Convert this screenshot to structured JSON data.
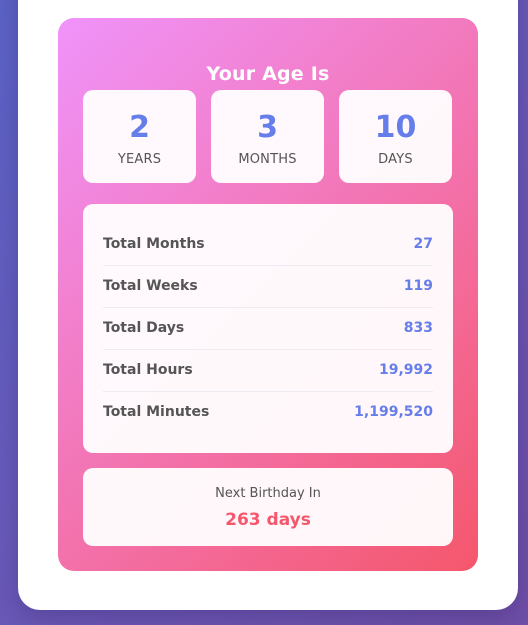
{
  "result": {
    "title": "Your Age Is",
    "years": {
      "value": "2",
      "label": "YEARS"
    },
    "months": {
      "value": "3",
      "label": "MONTHS"
    },
    "days": {
      "value": "10",
      "label": "DAYS"
    }
  },
  "stats": [
    {
      "label": "Total Months",
      "value": "27"
    },
    {
      "label": "Total Weeks",
      "value": "119"
    },
    {
      "label": "Total Days",
      "value": "833"
    },
    {
      "label": "Total Hours",
      "value": "19,992"
    },
    {
      "label": "Total Minutes",
      "value": "1,199,520"
    }
  ],
  "next_birthday": {
    "label": "Next Birthday In",
    "value": "263 days"
  },
  "colors": {
    "accent": "#667eea",
    "gradient_start": "#f093fb",
    "gradient_end": "#f5576c",
    "background": "#6a58b6"
  }
}
